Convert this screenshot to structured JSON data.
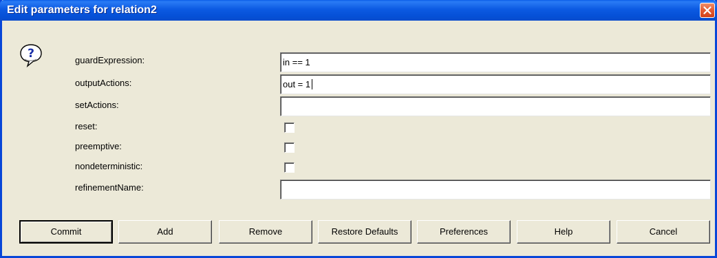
{
  "dialog": {
    "title": "Edit parameters for relation2"
  },
  "icons": {
    "help": "question-icon",
    "close": "close-icon"
  },
  "parameters": [
    {
      "label": "guardExpression:",
      "type": "text",
      "value": "in == 1"
    },
    {
      "label": "outputActions:",
      "type": "text",
      "value": "out = 1"
    },
    {
      "label": "setActions:",
      "type": "text",
      "value": ""
    },
    {
      "label": "reset:",
      "type": "checkbox",
      "checked": false
    },
    {
      "label": "preemptive:",
      "type": "checkbox",
      "checked": false
    },
    {
      "label": "nondeterministic:",
      "type": "checkbox",
      "checked": false
    },
    {
      "label": "refinementName:",
      "type": "text",
      "value": ""
    }
  ],
  "buttons": {
    "commit": "Commit",
    "add": "Add",
    "remove": "Remove",
    "restore_defaults": "Restore Defaults",
    "preferences": "Preferences",
    "help": "Help",
    "cancel": "Cancel"
  },
  "colors": {
    "title_bar": "#0a5ee8",
    "dialog_bg": "#ece9d8",
    "close_button": "#e45a32"
  }
}
